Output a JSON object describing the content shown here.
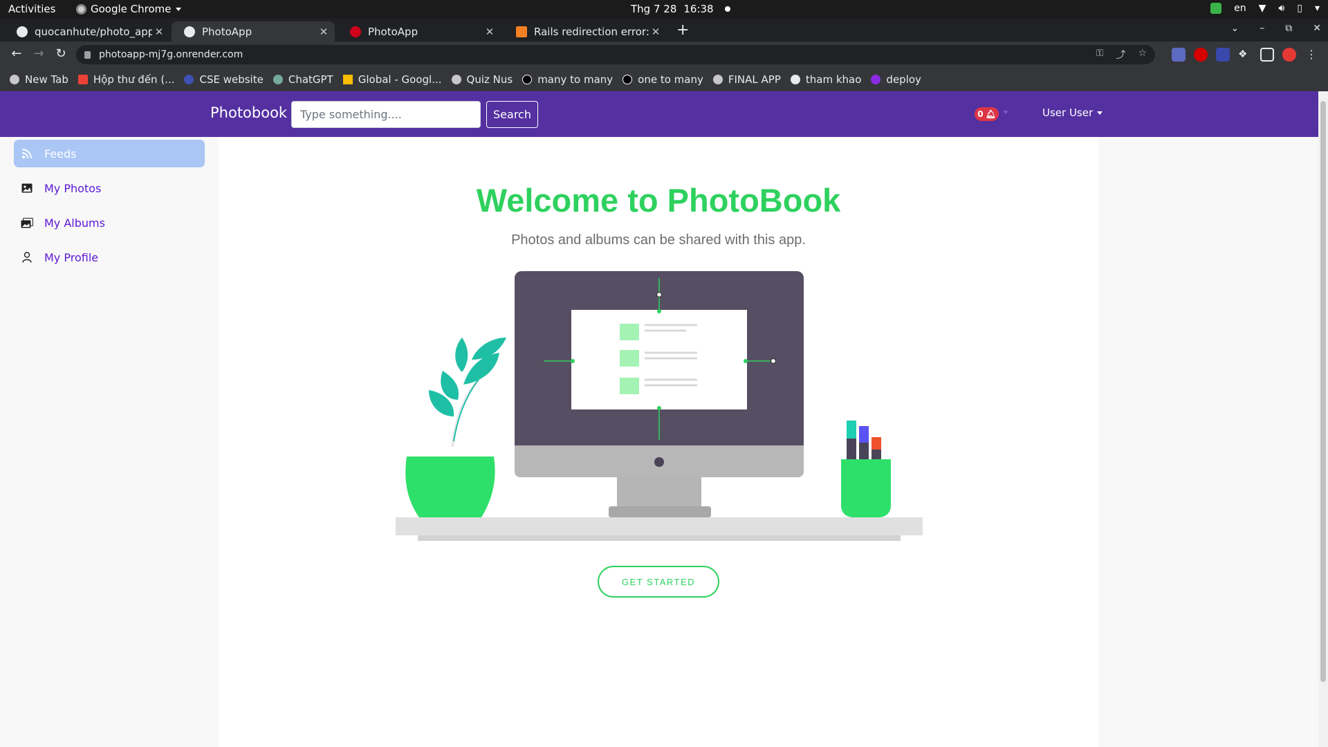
{
  "system_bar": {
    "activities": "Activities",
    "app_name": "Google Chrome",
    "date": "Thg 7 28",
    "time": "16:38",
    "lang": "en"
  },
  "tabs": [
    {
      "title": "quocanhute/photo_app",
      "active": false
    },
    {
      "title": "PhotoApp",
      "active": true
    },
    {
      "title": "PhotoApp",
      "active": false
    },
    {
      "title": "Rails redirection error: Un",
      "active": false
    }
  ],
  "address_bar": {
    "url": "photoapp-mj7g.onrender.com"
  },
  "bookmarks": [
    "New Tab",
    "Hộp thư đến (...",
    "CSE website",
    "ChatGPT",
    "Global - Googl...",
    "Quiz Nus",
    "many to many",
    "one to many",
    "FINAL APP",
    "tham khao",
    "deploy"
  ],
  "navbar": {
    "brand": "Photobook",
    "search_placeholder": "Type something....",
    "search_button": "Search",
    "notification_count": "0",
    "user": "User User"
  },
  "sidebar": {
    "items": [
      {
        "label": "Feeds",
        "icon": "rss-icon",
        "active": true
      },
      {
        "label": "My Photos",
        "icon": "image-icon",
        "active": false
      },
      {
        "label": "My Albums",
        "icon": "images-icon",
        "active": false
      },
      {
        "label": "My Profile",
        "icon": "person-icon",
        "active": false
      }
    ]
  },
  "main": {
    "title": "Welcome to PhotoBook",
    "subtitle": "Photos and albums can be shared with this app.",
    "cta": "GET STARTED"
  },
  "colors": {
    "navbar": "#5430a1",
    "accent_green": "#2ed15e",
    "link_purple": "#5b17d6",
    "active_item": "#a9c6f5"
  }
}
